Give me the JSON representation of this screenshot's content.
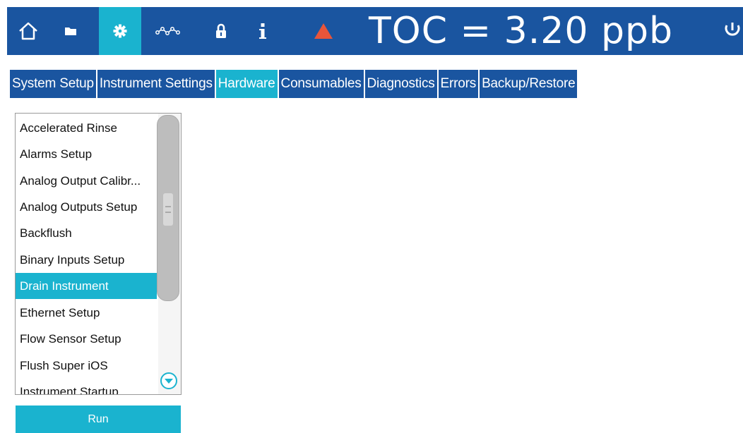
{
  "header": {
    "nav_icons": [
      "home-icon",
      "folder-icon",
      "gear-icon",
      "trend-icon",
      "lock-icon",
      "info-icon",
      "alarm-triangle-icon"
    ],
    "active_nav": "gear-icon",
    "reading": "TOC = 3.20 ppb",
    "power_icon": "power-icon",
    "colors": {
      "bar": "#1a55a0",
      "accent": "#1ab3cf",
      "alarm": "#e8553a"
    }
  },
  "tabs": [
    {
      "label": "System Setup"
    },
    {
      "label": "Instrument Settings"
    },
    {
      "label": "Hardware"
    },
    {
      "label": "Consumables"
    },
    {
      "label": "Diagnostics"
    },
    {
      "label": "Errors"
    },
    {
      "label": "Backup/Restore"
    }
  ],
  "active_tab": "Hardware",
  "list": {
    "items": [
      "Accelerated Rinse",
      "Alarms Setup",
      "Analog Output Calibr...",
      "Analog Outputs Setup",
      "Backflush",
      "Binary Inputs Setup",
      "Drain Instrument",
      "Ethernet Setup",
      "Flow Sensor Setup",
      "Flush Super iOS",
      "Instrument Startup"
    ],
    "selected": "Drain Instrument"
  },
  "run_button": {
    "label": "Run"
  }
}
